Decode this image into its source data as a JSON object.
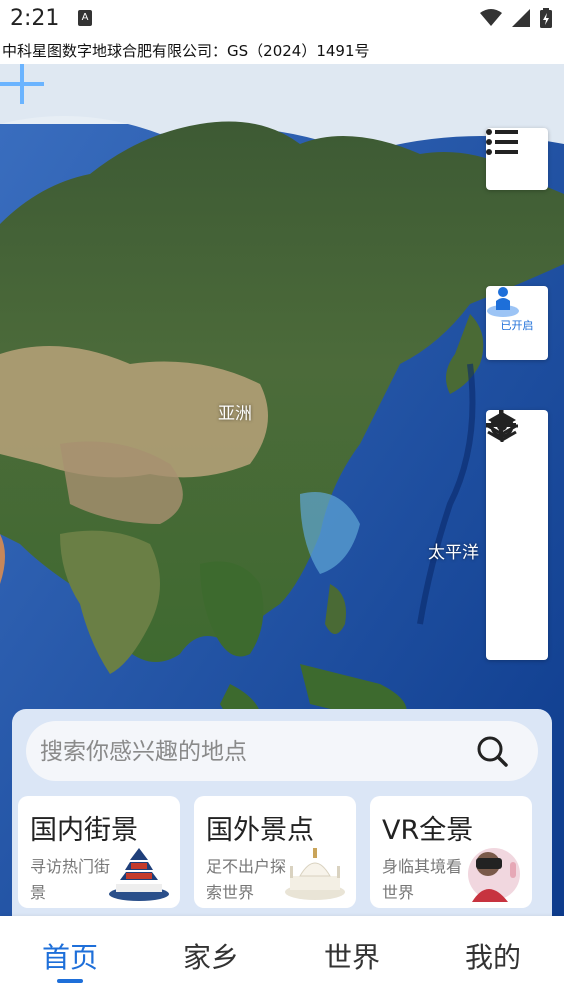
{
  "status_bar": {
    "time": "2:21",
    "notification_glyph": "A"
  },
  "copyright": "中科星图数字地球合肥有限公司：GS（2024）1491号",
  "map": {
    "labels": {
      "continent": "亚洲",
      "ocean": "太平洋"
    },
    "controls": {
      "street_view_label": "已开启",
      "icons": [
        "list-icon",
        "street-view-person-icon",
        "layers-icon",
        "zoom-in-icon",
        "zoom-out-icon",
        "locate-icon"
      ]
    }
  },
  "search": {
    "placeholder": "搜索你感兴趣的地点"
  },
  "cards": [
    {
      "title": "国内街景",
      "sub": "寻访热门街景"
    },
    {
      "title": "国外景点",
      "sub": "足不出户探索世界"
    },
    {
      "title": "VR全景",
      "sub": "身临其境看世界"
    }
  ],
  "nav": {
    "home": "首页",
    "hometown": "家乡",
    "world": "世界",
    "mine": "我的",
    "active": "home"
  },
  "colors": {
    "accent": "#1e6fd9",
    "panel": "#dbe6f6",
    "ocean": "#1c4fa0"
  }
}
